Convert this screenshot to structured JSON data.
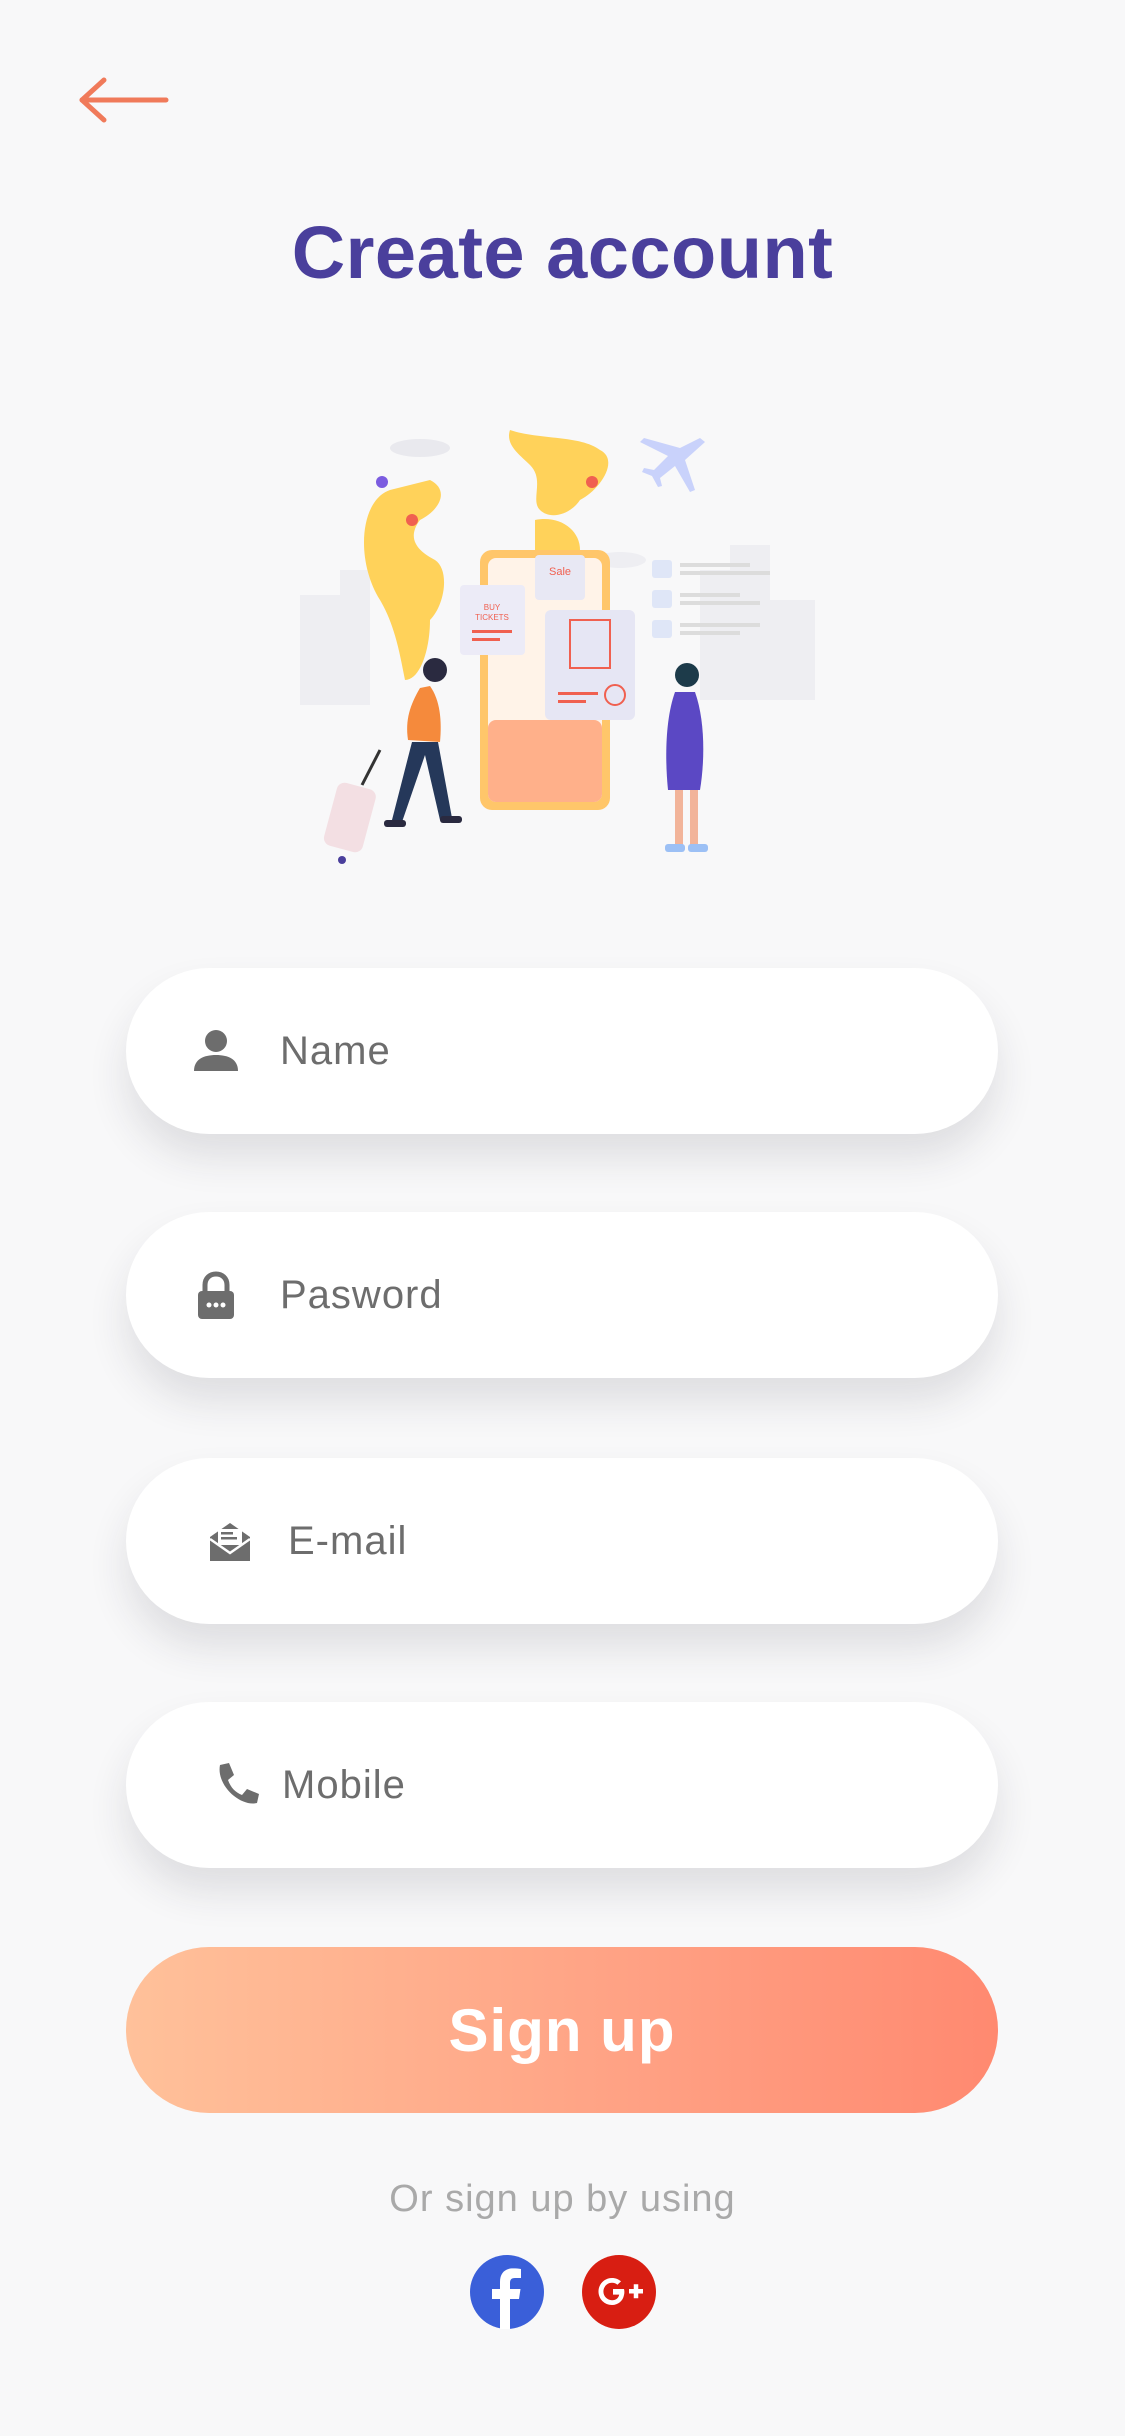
{
  "header": {
    "back_icon": "arrow-left-icon",
    "title": "Create account"
  },
  "illustration": {
    "sale_label": "Sale",
    "buy_line1": "BUY",
    "buy_line2": "TICKETS"
  },
  "form": {
    "name": {
      "icon": "person-icon",
      "placeholder": "Name",
      "value": ""
    },
    "password": {
      "icon": "lock-icon",
      "placeholder": "Pasword",
      "value": ""
    },
    "email": {
      "icon": "envelope-icon",
      "placeholder": "E-mail",
      "value": ""
    },
    "mobile": {
      "icon": "phone-icon",
      "placeholder": "Mobile",
      "value": ""
    }
  },
  "signup_button": {
    "label": "Sign up"
  },
  "social": {
    "label": "Or sign up by using",
    "facebook_icon": "facebook-icon",
    "google_icon": "google-plus-icon"
  },
  "colors": {
    "accent_title": "#4a3f9c",
    "back_arrow": "#f07a5a",
    "button_gradient_start": "#ffc19a",
    "button_gradient_end": "#ff8970",
    "facebook": "#3a5fd9",
    "google": "#d81e12"
  }
}
